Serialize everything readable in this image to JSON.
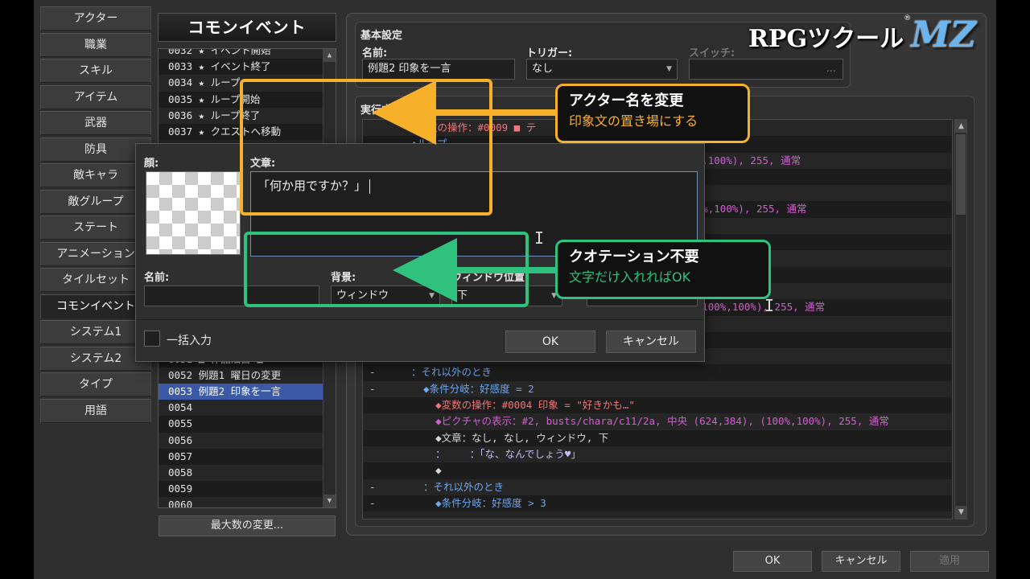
{
  "colors": {
    "orange": "#f7b02a",
    "green": "#2ec27e",
    "selection": "#3b5aa6",
    "pink": "#f07878",
    "purple": "#d060d0",
    "blue": "#6ea8f0",
    "lavender": "#c8b8f0"
  },
  "nav": [
    "アクター",
    "職業",
    "スキル",
    "アイテム",
    "武器",
    "防具",
    "敵キャラ",
    "敵グループ",
    "ステート",
    "アニメーション",
    "タイルセット",
    "コモンイベント",
    "システム1",
    "システム2",
    "タイプ",
    "用語"
  ],
  "nav_selected": "コモンイベント",
  "common_events": {
    "header": "コモンイベント",
    "rows": [
      "0032 ★ イベント開始",
      "0033 ★ イベント終了",
      "0034 ★ ループ",
      "0035 ★ ループ開始",
      "0036 ★ ループ終了",
      "0037 ★ クエストへ移動",
      "",
      "",
      "",
      "",
      "",
      "",
      "",
      "",
      "",
      "",
      "",
      "",
      "",
      "0051 ■ 作品法目 ■",
      "0052 例題1 曜日の変更",
      "0053 例題2 印象を一言",
      "0054",
      "0055",
      "0056",
      "0057",
      "0058",
      "0059",
      "0060"
    ],
    "selected_row": "0053 例題2 印象を一言",
    "max_button": "最大数の変更..."
  },
  "basic": {
    "title": "基本設定",
    "name_label": "名前:",
    "name_value": "例題2 印象を一言",
    "trigger_label": "トリガー:",
    "trigger_value": "なし",
    "switch_label": "スイッチ:",
    "switch_value": "..."
  },
  "content": {
    "title": "実行内容",
    "commands": [
      {
        "m": "",
        "t": "◆変数の操作：#0009 ■ テ",
        "c": "pink"
      },
      {
        "m": "-",
        "t": "◆ループ",
        "c": "blue"
      },
      {
        "m": "",
        "t": "                                        ), (100%,100%), 255, 通常",
        "c": "purple"
      },
      {
        "m": "",
        "t": "",
        "c": "plain"
      },
      {
        "m": "",
        "t": "",
        "c": "plain"
      },
      {
        "m": "",
        "t": "                                        4), (100%,100%), 255, 通常",
        "c": "purple"
      },
      {
        "m": "",
        "t": "",
        "c": "plain"
      },
      {
        "m": "",
        "t": "",
        "c": "plain"
      },
      {
        "m": "",
        "t": "",
        "c": "plain"
      },
      {
        "m": "",
        "t": "",
        "c": "plain"
      },
      {
        "m": "",
        "t": "",
        "c": "plain"
      },
      {
        "m": "",
        "t": "                                        ,384), (100%,100%), 255, 通常",
        "c": "purple"
      },
      {
        "m": "",
        "t": "",
        "c": "plain"
      },
      {
        "m": "",
        "t": "",
        "c": "plain"
      },
      {
        "m": "",
        "t": "  ◆",
        "c": "plain"
      },
      {
        "m": "-",
        "t": "：それ以外のとき",
        "c": "blue"
      },
      {
        "m": "-",
        "t": "  ◆条件分岐：好感度 = 2",
        "c": "blue"
      },
      {
        "m": "",
        "t": "    ◆変数の操作：#0004 印象 = \"好きかも…\"",
        "c": "pink"
      },
      {
        "m": "",
        "t": "    ◆ピクチャの表示：#2, busts/chara/c11/2a, 中央 (624,384), (100%,100%), 255, 通常",
        "c": "purple"
      },
      {
        "m": "",
        "t": "    ◆文章：なし, なし, ウィンドウ, 下",
        "c": "plain"
      },
      {
        "m": "",
        "t": "    ：    ：「な、なんでしょう♥」",
        "c": "lavender"
      },
      {
        "m": "",
        "t": "    ◆",
        "c": "plain"
      },
      {
        "m": "-",
        "t": "  ：それ以外のとき",
        "c": "blue"
      },
      {
        "m": "-",
        "t": "    ◆条件分岐：好感度 > 3",
        "c": "blue"
      },
      {
        "m": "",
        "t": "",
        "c": "plain"
      }
    ]
  },
  "logo": {
    "rpg": "RPGツクール",
    "mz": "MZ",
    "reg": "®"
  },
  "bottom": {
    "ok": "OK",
    "cancel": "キャンセル",
    "apply": "適用"
  },
  "message_window": {
    "face_label": "顔:",
    "text_label": "文章:",
    "text_value": "「何か用ですか？」",
    "name_label": "名前:",
    "name_value": "",
    "bg_label": "背景:",
    "bg_value": "ウィンドウ",
    "pos_label": "ウィンドウ位置:",
    "pos_value": "下",
    "batch_label": "一括入力",
    "ok": "OK",
    "cancel": "キャンセル"
  },
  "callouts": {
    "orange_title": "アクター名を変更",
    "orange_sub": "印象文の置き場にする",
    "green_title": "クオテーション不要",
    "green_sub": "文字だけ入れればOK"
  }
}
